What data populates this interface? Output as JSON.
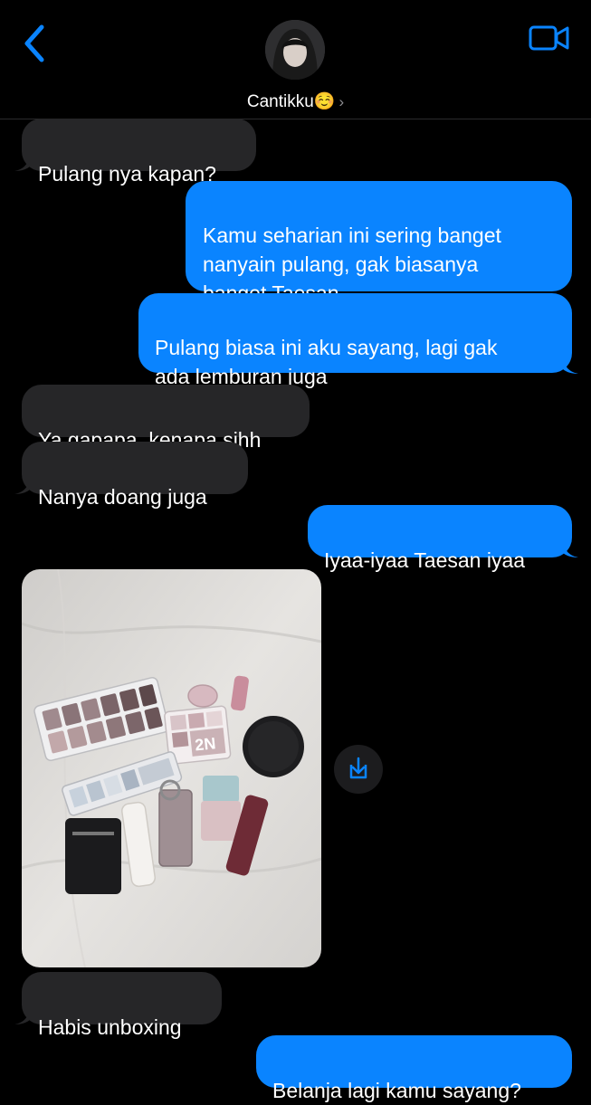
{
  "header": {
    "contact_name": "Cantikku☺️",
    "chevron": "›"
  },
  "icons": {
    "back": "chevron-left-icon",
    "video": "video-camera-icon",
    "save": "download-icon"
  },
  "colors": {
    "sent_bubble": "#0a84ff",
    "received_bubble": "#262628",
    "background": "#000000",
    "accent": "#0a84ff"
  },
  "messages": [
    {
      "from": "them",
      "text": "Pulang nya kapan?"
    },
    {
      "from": "me",
      "text": "Kamu seharian ini sering banget\nnanyain pulang, gak biasanya\nbanget Taesan"
    },
    {
      "from": "me",
      "text": "Pulang biasa ini aku sayang, lagi gak\nada lemburan juga"
    },
    {
      "from": "them",
      "text": "Ya gapapa, kenapa sihh"
    },
    {
      "from": "them",
      "text": "Nanya doang juga"
    },
    {
      "from": "me",
      "text": "Iyaa-iyaa Taesan iyaa"
    },
    {
      "from": "them",
      "type": "photo",
      "text": ""
    },
    {
      "from": "them",
      "text": "Habis unboxing"
    },
    {
      "from": "me",
      "text": "Belanja lagi kamu sayang?"
    }
  ]
}
